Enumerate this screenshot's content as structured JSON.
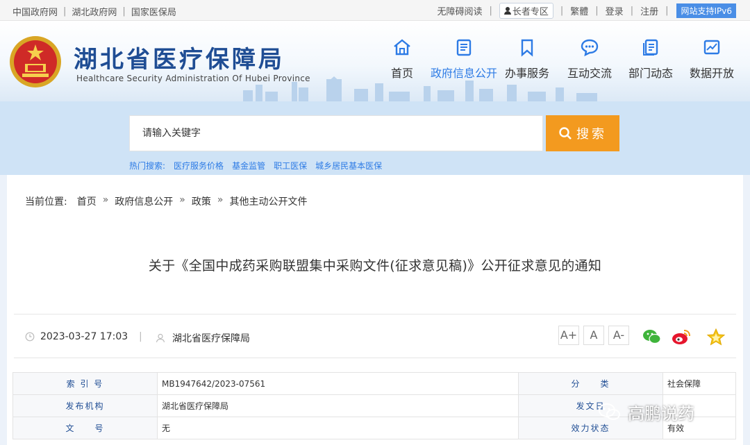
{
  "topbar": {
    "links": [
      "中国政府网",
      "湖北政府网",
      "国家医保局"
    ],
    "right": {
      "accessible": "无障碍阅读",
      "elder": "长者专区",
      "traditional": "繁體",
      "login": "登录",
      "register": "注册",
      "ipv6": "网站支持IPv6"
    }
  },
  "header": {
    "title": "湖北省医疗保障局",
    "subtitle": "Healthcare Security Administration Of Hubei Province",
    "nav": [
      {
        "label": "首页",
        "icon": "home-icon"
      },
      {
        "label": "政府信息公开",
        "icon": "document-list-icon"
      },
      {
        "label": "办事服务",
        "icon": "bookmark-icon"
      },
      {
        "label": "互动交流",
        "icon": "chat-icon"
      },
      {
        "label": "部门动态",
        "icon": "news-icon"
      },
      {
        "label": "数据开放",
        "icon": "chart-icon"
      }
    ],
    "active_nav": "政府信息公开"
  },
  "search": {
    "placeholder": "请输入关键字",
    "button": "搜索",
    "hot_label": "热门搜索:",
    "hot": [
      "医疗服务价格",
      "基金监管",
      "职工医保",
      "城乡居民基本医保"
    ]
  },
  "breadcrumb": {
    "label": "当前位置:",
    "items": [
      "首页",
      "政府信息公开",
      "政策",
      "其他主动公开文件"
    ],
    "sep": "»"
  },
  "article": {
    "title": "关于《全国中成药采购联盟集中采购文件(征求意见稿)》公开征求意见的通知",
    "datetime": "2023-03-27 17:03",
    "source": "湖北省医疗保障局",
    "font_sizes": [
      "A+",
      "A",
      "A-"
    ]
  },
  "info_table": {
    "rows": [
      {
        "l1": "索 引 号",
        "v1": "MB1947642/2023-07561",
        "l2": "分　　类",
        "v2": "社会保障"
      },
      {
        "l1": "发布机构",
        "v1": "湖北省医疗保障局",
        "l2": "发文日",
        "v2": ""
      },
      {
        "l1": "文　　号",
        "v1": "无",
        "l2": "效力状态",
        "v2": "有效"
      }
    ]
  },
  "watermark": "高鹏说药",
  "colors": {
    "brand": "#1f4d94",
    "accent": "#2d7be5",
    "search_button": "#f39a1f"
  }
}
